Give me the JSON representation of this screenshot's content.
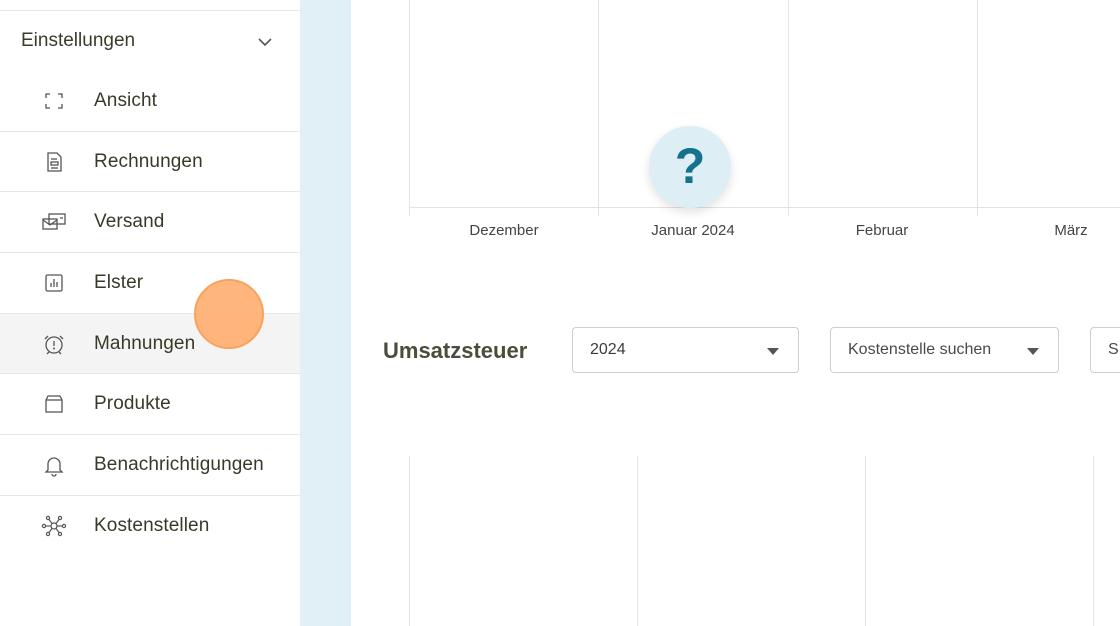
{
  "sidebar": {
    "section_label": "Einstellungen",
    "items": [
      {
        "label": "Ansicht",
        "icon": "fullscreen-icon"
      },
      {
        "label": "Rechnungen",
        "icon": "invoice-icon"
      },
      {
        "label": "Versand",
        "icon": "mail-icon"
      },
      {
        "label": "Elster",
        "icon": "chart-icon"
      },
      {
        "label": "Mahnungen",
        "icon": "alarm-clock-icon"
      },
      {
        "label": "Produkte",
        "icon": "box-icon"
      },
      {
        "label": "Benachrichtigungen",
        "icon": "bell-icon"
      },
      {
        "label": "Kostenstellen",
        "icon": "network-icon"
      }
    ]
  },
  "chart_top": {
    "months": [
      "Dezember",
      "Januar 2024",
      "Februar",
      "März"
    ]
  },
  "help": {
    "symbol": "?"
  },
  "vat": {
    "title": "Umsatzsteuer",
    "year_value": "2024",
    "cost_center_placeholder": "Kostenstelle suchen",
    "search_fragment": "S"
  },
  "colors": {
    "strip": "#e1f0f7",
    "help_bg": "#ddeff5",
    "help_fg": "#13738f",
    "click_indicator": "#ffa865"
  }
}
